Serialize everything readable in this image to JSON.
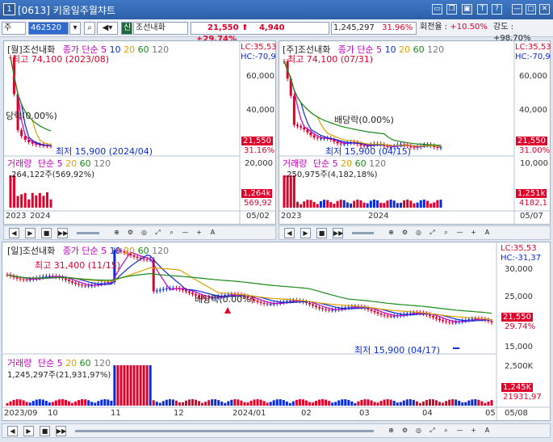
{
  "window": {
    "num": "1",
    "title": "[0613] 키움일주월챠트",
    "btns": [
      "▭",
      "❐",
      "▣",
      "T",
      "?",
      "—",
      "▢",
      "✕"
    ]
  },
  "toolbar": {
    "market": "주",
    "code": "462520",
    "badge": "신",
    "name": "조선내화",
    "price": "21,550",
    "arrow": "⬆",
    "change": "4,940",
    "pct": "+29.74%",
    "volume": "1,245,297",
    "vol_pct": "31.96%",
    "turnover_label": "회전율 :",
    "turnover": "+10.50%",
    "strength_label": "강도 :",
    "strength": "+98.70%"
  },
  "monthly": {
    "title": "[월]조선내화",
    "ma_label": "종가 단순",
    "ma": [
      "5",
      "10",
      "20",
      "60",
      "120"
    ],
    "high": "최고 74,100 (2023/08)",
    "low": "최저 15,900 (2024/04)",
    "div": "당락(0.00%)",
    "lc": "LC:35,53",
    "hc": "HC:-70,9",
    "y_ticks": [
      "60,000",
      "40,000"
    ],
    "price": "21,550",
    "pct": "31.16%",
    "vol_title": "거래량",
    "vol_ma_label": "단순",
    "vol_ma": [
      "5",
      "20",
      "60",
      "120"
    ],
    "vol_text": ",264,122주(569,92%)",
    "vol_tick": "20,000",
    "vol_tag": "1,264k",
    "vol_tag2": "569,92",
    "x": [
      "2023",
      "2024"
    ],
    "date": "05/02"
  },
  "weekly": {
    "title": "[주]조선내화",
    "ma_label": "종가 단순",
    "ma": [
      "5",
      "10",
      "20",
      "60",
      "120"
    ],
    "high": "최고 74,100 (07/31)",
    "low": "최저 15,900 (04/15)",
    "div": "배당락(0.00%)",
    "lc": "LC:35,53",
    "hc": "HC:-70,9",
    "y_ticks": [
      "60,000",
      "40,000"
    ],
    "price": "21,550",
    "pct": "31.00%",
    "vol_title": "거래량",
    "vol_ma_label": "단순",
    "vol_ma": [
      "5",
      "20",
      "60",
      "120"
    ],
    "vol_text": ",250,975주(4,182,18%)",
    "vol_tick": "10,000",
    "vol_tag": "1,251k",
    "vol_tag2": "4182,1",
    "x": [
      "2023",
      "2024"
    ],
    "date": "05/07"
  },
  "daily": {
    "title": "[일]조선내화",
    "ma_label": "종가 단순",
    "ma": [
      "5",
      "10",
      "20",
      "60",
      "120"
    ],
    "high": "최고 31,400 (11/15)",
    "low": "최저 15,900 (04/17)",
    "div": "배당락(0.00%)",
    "lc": "LC:35,53",
    "hc": "HC:-31,37",
    "y_ticks": [
      "30,000",
      "25,000",
      "15,000"
    ],
    "price": "21,550",
    "pct": "29.74%",
    "vol_title": "거래량",
    "vol_ma_label": "단순",
    "vol_ma": [
      "5",
      "20",
      "60",
      "120"
    ],
    "vol_text": "1,245,297주(21,931,97%)",
    "vol_tick": "2,500K",
    "vol_tag": "1,245K",
    "vol_tag2": "21931,97",
    "x": [
      "2023/09",
      "10",
      "11",
      "12",
      "2024/01",
      "02",
      "03",
      "04",
      "05"
    ],
    "date": "05/08"
  },
  "ctrl": [
    "◀",
    "▶",
    "■",
    "▶▶",
    "⊕",
    "⚙",
    "◎",
    "⤢",
    "⌕",
    "—",
    "+",
    "A"
  ],
  "colors": {
    "up": "#e0002a",
    "down": "#0a2bd6",
    "ma5": "#c000c0",
    "ma10": "#0a2bd6",
    "ma20": "#e0a000",
    "ma60": "#1a8a1a",
    "ma120": "#777777"
  }
}
